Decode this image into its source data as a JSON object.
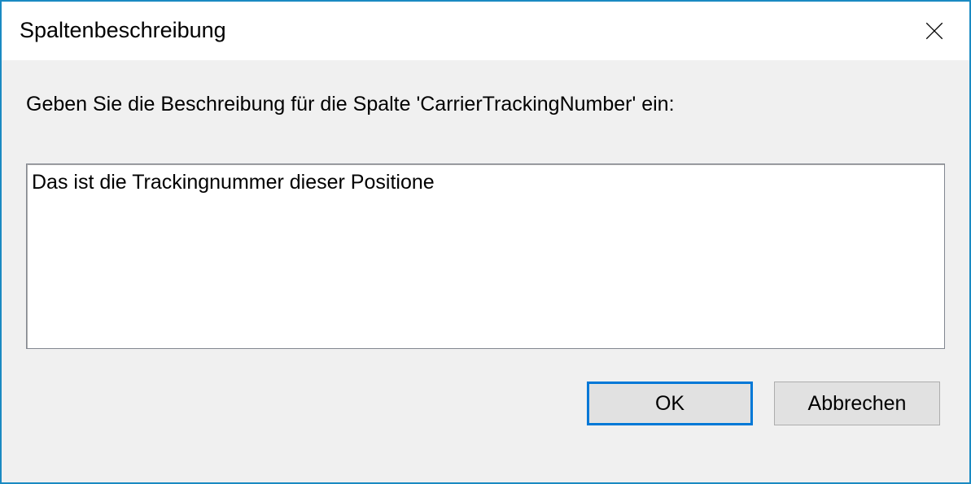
{
  "dialog": {
    "title": "Spaltenbeschreibung",
    "prompt": "Geben Sie die Beschreibung für die Spalte 'CarrierTrackingNumber' ein:",
    "input_value": "Das ist die Trackingnummer dieser Positione",
    "ok_label": "OK",
    "cancel_label": "Abbrechen"
  }
}
